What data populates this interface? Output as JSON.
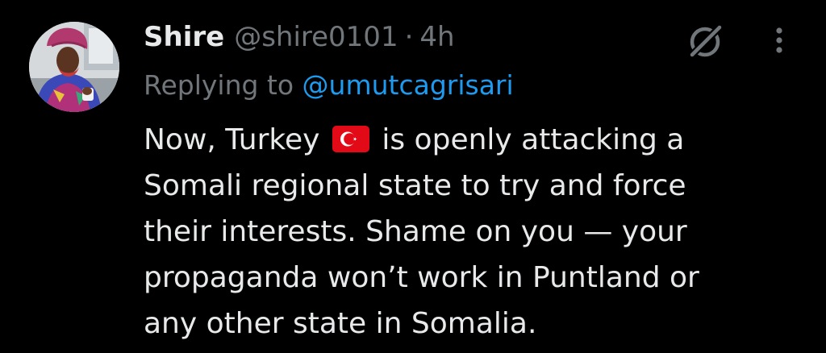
{
  "author": {
    "display_name": "Shire",
    "handle": "@shire0101",
    "separator": "·",
    "timestamp": "4h",
    "avatar_icon": "user-avatar-photo"
  },
  "reply": {
    "prefix": "Replying to ",
    "mention": "@umutcagrisari"
  },
  "tweet": {
    "line1_before_flag": "Now, Turkey",
    "flag_icon": "turkey-flag-icon",
    "line1_after_flag": "is openly attacking a",
    "line2": "Somali regional state to try and force",
    "line3": "their interests. Shame on you — your",
    "line4": "propaganda won’t work in Puntland or",
    "line5": "any other state in Somalia."
  },
  "actions": {
    "grok_icon": "grok-icon",
    "more_icon": "more-vertical-icon"
  },
  "colors": {
    "background": "#000000",
    "primary_text": "#e7e9ea",
    "secondary_text": "#71767b",
    "link": "#1d9bf0",
    "flag_red": "#e30a17"
  }
}
